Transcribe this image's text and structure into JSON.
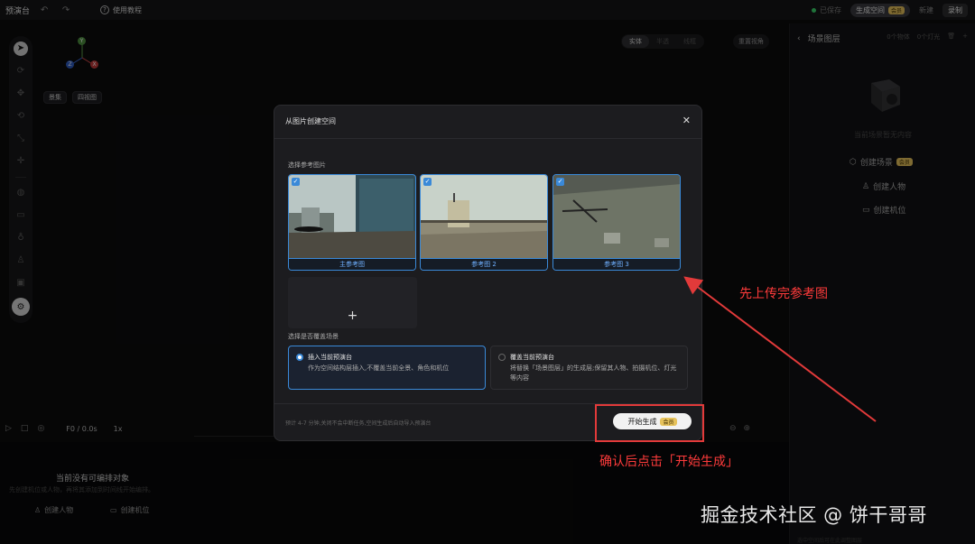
{
  "topbar": {
    "title": "预演台",
    "tutorial": "使用教程",
    "saved": "已保存",
    "gen_space": "生成空间",
    "vip": "会员",
    "plain": "新建",
    "record": "录制"
  },
  "viewport": {
    "gizmo_labels": [
      "Y",
      "Z",
      "X"
    ],
    "btn_preset": "景集",
    "btn_four": "四视图",
    "mode_tabs": [
      "实体",
      "半透",
      "线框"
    ],
    "reset_view": "重置视角"
  },
  "right_panel": {
    "title": "场景图层",
    "meta_a": "0个物体",
    "meta_b": "0个灯光",
    "empty": "当前场景暂无内容",
    "create_scene": "创建场景",
    "create_scene_badge": "会员",
    "create_person": "创建人物",
    "create_camera": "创建机位",
    "footer": "选中空间后可在此调整图层"
  },
  "timeline": {
    "frame": "F0 / 0.0s",
    "speed": "1x"
  },
  "bottom": {
    "no_obj": "当前没有可编排对象",
    "no_obj_sub": "先创建机位或人物，再将其添加到时间线开始编排。",
    "create_person": "创建人物",
    "create_camera": "创建机位"
  },
  "modal": {
    "title": "从图片创建空间",
    "ref_label": "选择参考图片",
    "thumbs": [
      "主参考图",
      "参考图 2",
      "参考图 3"
    ],
    "overwrite_label": "选择是否覆盖场景",
    "opt_a_title": "插入当前预演台",
    "opt_a_desc": "作为空间结构层插入,不覆盖当前全景、角色和机位",
    "opt_b_title": "覆盖当前预演台",
    "opt_b_desc": "将替换「场景图层」的生成层;保留其人物、拍摄机位、灯光等内容",
    "footnote": "预计 4-7 分钟,关闭不会中断任务,空间生成后自动导入预演台",
    "start": "开始生成",
    "start_badge": "会员"
  },
  "annotations": {
    "upload": "先上传完参考图",
    "confirm": "确认后点击「开始生成」",
    "watermark": "掘金技术社区 @ 饼干哥哥"
  },
  "colors": {
    "accent": "#3a89d8",
    "annotation": "#e23a3a",
    "vip": "#e6c25b"
  }
}
